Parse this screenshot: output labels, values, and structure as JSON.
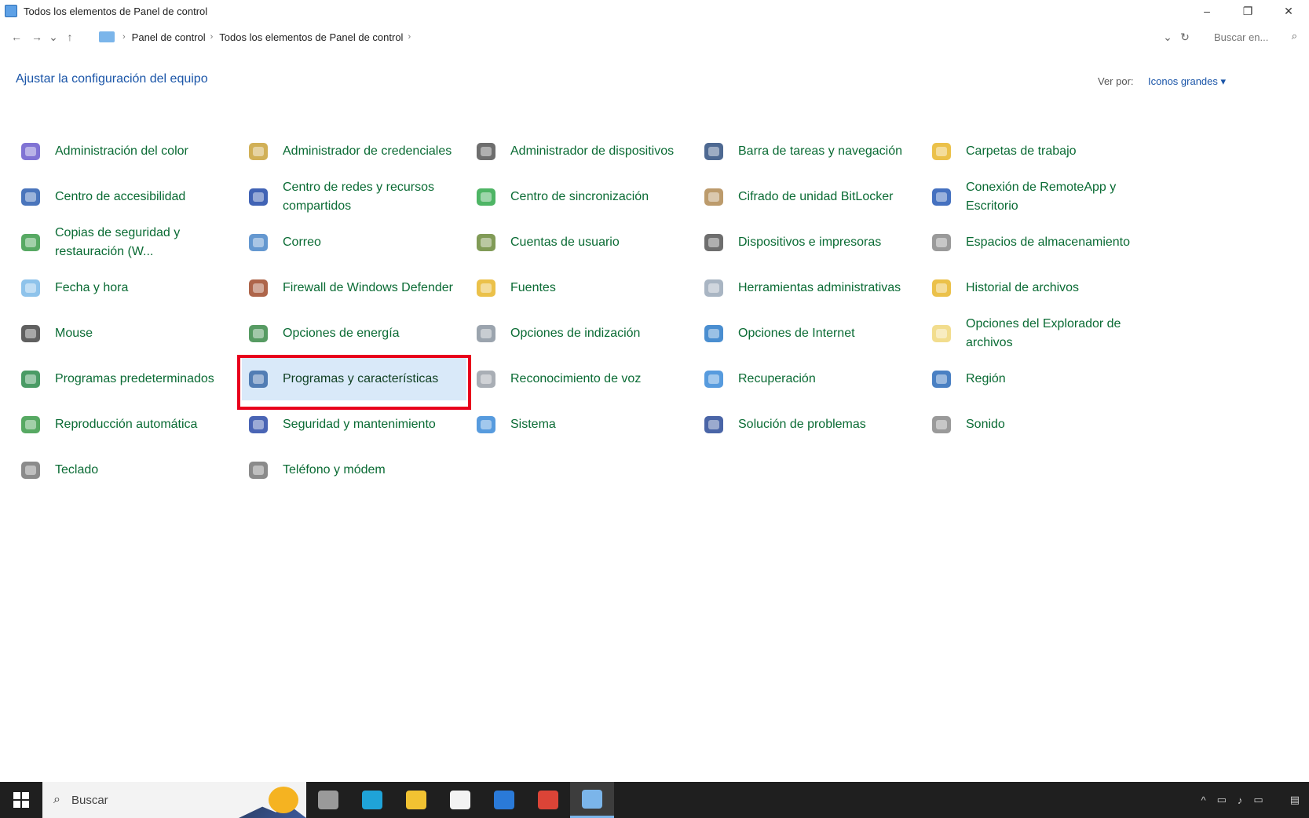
{
  "window": {
    "title": "Todos los elementos de Panel de control",
    "controls": {
      "minimize": "–",
      "maximize": "❐",
      "close": "✕"
    }
  },
  "address": {
    "back": "←",
    "forward": "→",
    "recent": "⌄",
    "up": "↑",
    "crumbs": [
      "Panel de control",
      "Todos los elementos de Panel de control"
    ],
    "crumb_sep": "›",
    "dropdown": "⌄",
    "refresh": "↻",
    "search_placeholder": "Buscar en...",
    "search_icon": "⌕"
  },
  "header": {
    "title": "Ajustar la configuración del equipo",
    "view_by_label": "Ver por:",
    "view_by_value": "Iconos grandes ▾"
  },
  "items": [
    {
      "label": "Administración del color",
      "icon": "color-management-icon",
      "color": "#6a5acd"
    },
    {
      "label": "Administrador de credenciales",
      "icon": "credential-manager-icon",
      "color": "#c9a23a"
    },
    {
      "label": "Administrador de dispositivos",
      "icon": "device-manager-icon",
      "color": "#555555"
    },
    {
      "label": "Barra de tareas y navegación",
      "icon": "taskbar-icon",
      "color": "#2f4f7f"
    },
    {
      "label": "Carpetas de trabajo",
      "icon": "work-folders-icon",
      "color": "#e8b62a"
    },
    {
      "label": "Centro de accesibilidad",
      "icon": "accessibility-icon",
      "color": "#2a5db0"
    },
    {
      "label": "Centro de redes y recursos compartidos",
      "icon": "network-center-icon",
      "color": "#2048a8"
    },
    {
      "label": "Centro de sincronización",
      "icon": "sync-center-icon",
      "color": "#2fa84a"
    },
    {
      "label": "Cifrado de unidad BitLocker",
      "icon": "bitlocker-icon",
      "color": "#b08a52"
    },
    {
      "label": "Conexión de RemoteApp y Escritorio",
      "icon": "remoteapp-icon",
      "color": "#2558b5"
    },
    {
      "label": "Copias de seguridad y restauración (W...",
      "icon": "backup-icon",
      "color": "#3a9a48"
    },
    {
      "label": "Correo",
      "icon": "mail-icon",
      "color": "#4a86c8"
    },
    {
      "label": "Cuentas de usuario",
      "icon": "user-accounts-icon",
      "color": "#6b8a3a"
    },
    {
      "label": "Dispositivos e impresoras",
      "icon": "printer-icon",
      "color": "#555555"
    },
    {
      "label": "Espacios de almacenamiento",
      "icon": "storage-spaces-icon",
      "color": "#888888"
    },
    {
      "label": "Fecha y hora",
      "icon": "clock-icon",
      "color": "#7ab8e8"
    },
    {
      "label": "Firewall de Windows Defender",
      "icon": "firewall-icon",
      "color": "#a04a2a"
    },
    {
      "label": "Fuentes",
      "icon": "fonts-icon",
      "color": "#e8b62a"
    },
    {
      "label": "Herramientas administrativas",
      "icon": "admin-tools-icon",
      "color": "#9aa8b8"
    },
    {
      "label": "Historial de archivos",
      "icon": "file-history-icon",
      "color": "#e8b62a"
    },
    {
      "label": "Mouse",
      "icon": "mouse-icon",
      "color": "#444444"
    },
    {
      "label": "Opciones de energía",
      "icon": "power-options-icon",
      "color": "#3a8a48"
    },
    {
      "label": "Opciones de indización",
      "icon": "indexing-icon",
      "color": "#8a94a0"
    },
    {
      "label": "Opciones de Internet",
      "icon": "internet-options-icon",
      "color": "#2a7ac8"
    },
    {
      "label": "Opciones del Explorador de archivos",
      "icon": "explorer-options-icon",
      "color": "#f0d77a"
    },
    {
      "label": "Programas predeterminados",
      "icon": "default-programs-icon",
      "color": "#2a8a4a"
    },
    {
      "label": "Programas y características",
      "icon": "programs-features-icon",
      "color": "#3a6aa8",
      "selected": true
    },
    {
      "label": "Reconocimiento de voz",
      "icon": "microphone-icon",
      "color": "#9aa0a8"
    },
    {
      "label": "Recuperación",
      "icon": "recovery-icon",
      "color": "#3a8ad8"
    },
    {
      "label": "Región",
      "icon": "region-icon",
      "color": "#2a6ab8"
    },
    {
      "label": "Reproducción automática",
      "icon": "autoplay-icon",
      "color": "#3a9a48"
    },
    {
      "label": "Seguridad y mantenimiento",
      "icon": "security-flag-icon",
      "color": "#2a4aa8"
    },
    {
      "label": "Sistema",
      "icon": "system-icon",
      "color": "#3a8ad8"
    },
    {
      "label": "Solución de problemas",
      "icon": "troubleshoot-icon",
      "color": "#2a4a98"
    },
    {
      "label": "Sonido",
      "icon": "speaker-icon",
      "color": "#888888"
    },
    {
      "label": "Teclado",
      "icon": "keyboard-icon",
      "color": "#777777"
    },
    {
      "label": "Teléfono y módem",
      "icon": "phone-modem-icon",
      "color": "#777777"
    }
  ],
  "taskbar": {
    "search_placeholder": "Buscar",
    "search_icon": "⌕",
    "apps": [
      {
        "name": "task-view",
        "icon": "task-view-icon",
        "color": "#9a9a9a"
      },
      {
        "name": "edge",
        "icon": "edge-icon",
        "color": "#1fa3d8"
      },
      {
        "name": "file-explorer",
        "icon": "folder-icon",
        "color": "#f1c232"
      },
      {
        "name": "store",
        "icon": "store-icon",
        "color": "#f3f3f3"
      },
      {
        "name": "mail",
        "icon": "mail-icon",
        "color": "#2a7ad8"
      },
      {
        "name": "chrome",
        "icon": "chrome-icon",
        "color": "#db4437"
      },
      {
        "name": "control-panel",
        "icon": "control-panel-icon",
        "color": "#7bb5ea",
        "active": true
      }
    ],
    "tray": {
      "chevron": "^",
      "network": "▭",
      "volume": "♪",
      "battery": "▭",
      "notifications": "▤"
    }
  }
}
